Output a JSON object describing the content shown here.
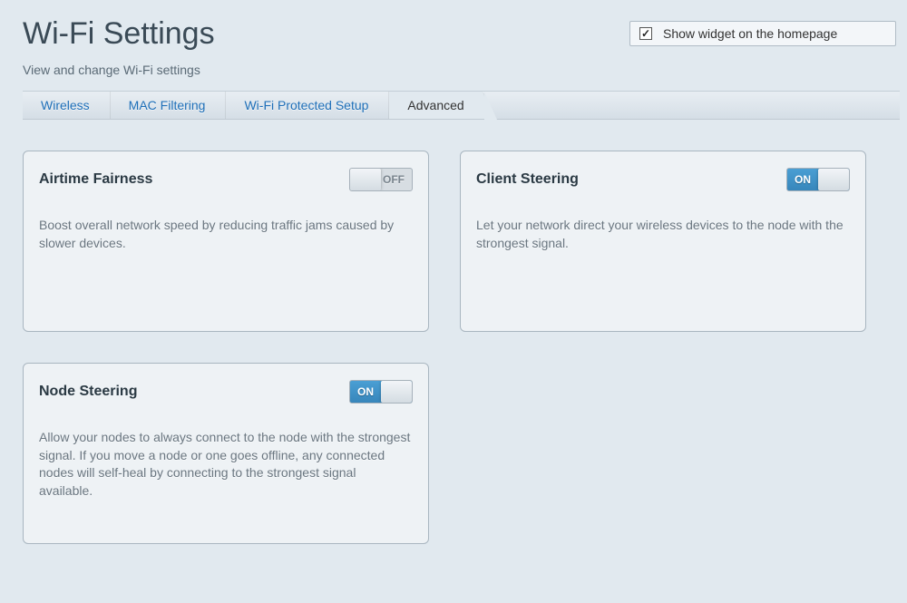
{
  "header": {
    "title": "Wi-Fi Settings",
    "subtitle": "View and change Wi-Fi settings",
    "widget_checkbox_label": "Show widget on the homepage",
    "widget_checkbox_checked": true
  },
  "tabs": [
    {
      "label": "Wireless",
      "active": false
    },
    {
      "label": "MAC Filtering",
      "active": false
    },
    {
      "label": "Wi-Fi Protected Setup",
      "active": false
    },
    {
      "label": "Advanced",
      "active": true
    }
  ],
  "toggle_labels": {
    "on": "ON",
    "off": "OFF"
  },
  "cards": {
    "airtime_fairness": {
      "title": "Airtime Fairness",
      "state": "off",
      "description": "Boost overall network speed by reducing traffic jams caused by slower devices."
    },
    "client_steering": {
      "title": "Client Steering",
      "state": "on",
      "description": "Let your network direct your wireless devices to the node with the strongest signal."
    },
    "node_steering": {
      "title": "Node Steering",
      "state": "on",
      "description": "Allow your nodes to always connect to the node with the strongest signal. If you move a node or one goes offline, any connected nodes will self-heal by connecting to the strongest signal available."
    }
  }
}
